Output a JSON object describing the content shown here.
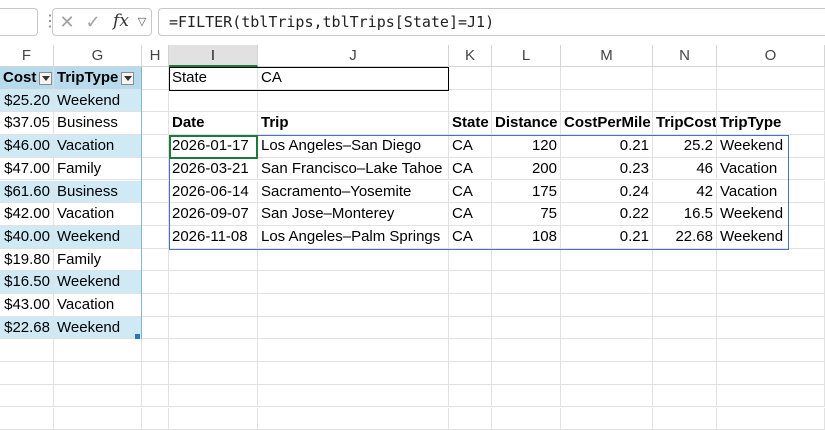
{
  "formula_bar": {
    "formula": "=FILTER(tblTrips,tblTrips[State]=J1)",
    "fx_label": "fx"
  },
  "columns": [
    "F",
    "G",
    "H",
    "I",
    "J",
    "K",
    "L",
    "M",
    "N",
    "O"
  ],
  "source_table": {
    "headers": [
      "Cost",
      "TripType"
    ],
    "rows": [
      [
        "$25.20",
        "Weekend"
      ],
      [
        "$37.05",
        "Business"
      ],
      [
        "$46.00",
        "Vacation"
      ],
      [
        "$47.00",
        "Family"
      ],
      [
        "$61.60",
        "Business"
      ],
      [
        "$42.00",
        "Vacation"
      ],
      [
        "$40.00",
        "Weekend"
      ],
      [
        "$19.80",
        "Family"
      ],
      [
        "$16.50",
        "Weekend"
      ],
      [
        "$43.00",
        "Vacation"
      ],
      [
        "$22.68",
        "Weekend"
      ]
    ]
  },
  "criteria": {
    "label": "State",
    "value": "CA"
  },
  "filter_result": {
    "headers": [
      "Date",
      "Trip",
      "State",
      "Distance",
      "CostPerMile",
      "TripCost",
      "TripType"
    ],
    "rows": [
      [
        "2026-01-17",
        "Los Angeles–San Diego",
        "CA",
        "120",
        "0.21",
        "25.2",
        "Weekend"
      ],
      [
        "2026-03-21",
        "San Francisco–Lake Tahoe",
        "CA",
        "200",
        "0.23",
        "46",
        "Vacation"
      ],
      [
        "2026-06-14",
        "Sacramento–Yosemite",
        "CA",
        "175",
        "0.24",
        "42",
        "Vacation"
      ],
      [
        "2026-09-07",
        "San Jose–Monterey",
        "CA",
        "75",
        "0.22",
        "16.5",
        "Weekend"
      ],
      [
        "2026-11-08",
        "Los Angeles–Palm Springs",
        "CA",
        "108",
        "0.21",
        "22.68",
        "Weekend"
      ]
    ]
  }
}
